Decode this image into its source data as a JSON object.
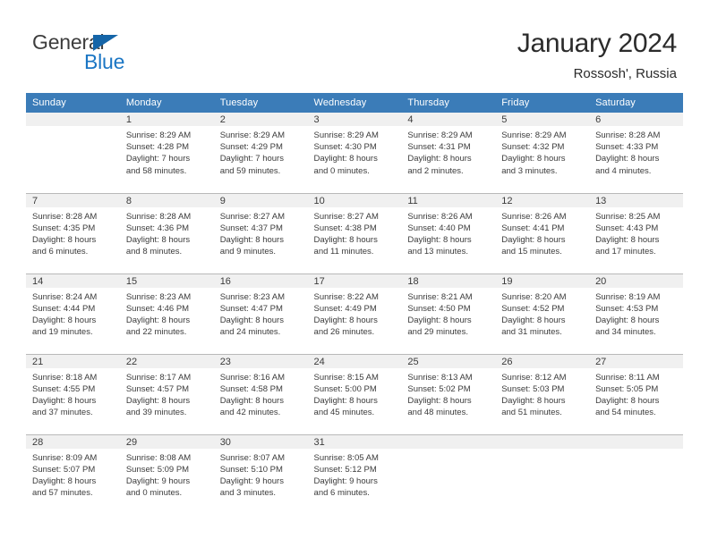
{
  "brand": {
    "name_part1": "General",
    "name_part2": "Blue",
    "triangle_color": "#1565a8",
    "blue_color": "#1b76c4"
  },
  "header": {
    "title": "January 2024",
    "subtitle": "Rossosh', Russia"
  },
  "theme": {
    "header_row_bg": "#3b7cb8",
    "daynum_bg": "#f0f0f0",
    "text_color": "#3b3b3b",
    "border_color": "#b9b9b9"
  },
  "weekdays": [
    "Sunday",
    "Monday",
    "Tuesday",
    "Wednesday",
    "Thursday",
    "Friday",
    "Saturday"
  ],
  "weeks": [
    [
      {
        "day": "",
        "blank": true,
        "sunrise": "",
        "sunset": "",
        "daylight1": "",
        "daylight2": ""
      },
      {
        "day": "1",
        "sunrise": "Sunrise: 8:29 AM",
        "sunset": "Sunset: 4:28 PM",
        "daylight1": "Daylight: 7 hours",
        "daylight2": "and 58 minutes."
      },
      {
        "day": "2",
        "sunrise": "Sunrise: 8:29 AM",
        "sunset": "Sunset: 4:29 PM",
        "daylight1": "Daylight: 7 hours",
        "daylight2": "and 59 minutes."
      },
      {
        "day": "3",
        "sunrise": "Sunrise: 8:29 AM",
        "sunset": "Sunset: 4:30 PM",
        "daylight1": "Daylight: 8 hours",
        "daylight2": "and 0 minutes."
      },
      {
        "day": "4",
        "sunrise": "Sunrise: 8:29 AM",
        "sunset": "Sunset: 4:31 PM",
        "daylight1": "Daylight: 8 hours",
        "daylight2": "and 2 minutes."
      },
      {
        "day": "5",
        "sunrise": "Sunrise: 8:29 AM",
        "sunset": "Sunset: 4:32 PM",
        "daylight1": "Daylight: 8 hours",
        "daylight2": "and 3 minutes."
      },
      {
        "day": "6",
        "sunrise": "Sunrise: 8:28 AM",
        "sunset": "Sunset: 4:33 PM",
        "daylight1": "Daylight: 8 hours",
        "daylight2": "and 4 minutes."
      }
    ],
    [
      {
        "day": "7",
        "sunrise": "Sunrise: 8:28 AM",
        "sunset": "Sunset: 4:35 PM",
        "daylight1": "Daylight: 8 hours",
        "daylight2": "and 6 minutes."
      },
      {
        "day": "8",
        "sunrise": "Sunrise: 8:28 AM",
        "sunset": "Sunset: 4:36 PM",
        "daylight1": "Daylight: 8 hours",
        "daylight2": "and 8 minutes."
      },
      {
        "day": "9",
        "sunrise": "Sunrise: 8:27 AM",
        "sunset": "Sunset: 4:37 PM",
        "daylight1": "Daylight: 8 hours",
        "daylight2": "and 9 minutes."
      },
      {
        "day": "10",
        "sunrise": "Sunrise: 8:27 AM",
        "sunset": "Sunset: 4:38 PM",
        "daylight1": "Daylight: 8 hours",
        "daylight2": "and 11 minutes."
      },
      {
        "day": "11",
        "sunrise": "Sunrise: 8:26 AM",
        "sunset": "Sunset: 4:40 PM",
        "daylight1": "Daylight: 8 hours",
        "daylight2": "and 13 minutes."
      },
      {
        "day": "12",
        "sunrise": "Sunrise: 8:26 AM",
        "sunset": "Sunset: 4:41 PM",
        "daylight1": "Daylight: 8 hours",
        "daylight2": "and 15 minutes."
      },
      {
        "day": "13",
        "sunrise": "Sunrise: 8:25 AM",
        "sunset": "Sunset: 4:43 PM",
        "daylight1": "Daylight: 8 hours",
        "daylight2": "and 17 minutes."
      }
    ],
    [
      {
        "day": "14",
        "sunrise": "Sunrise: 8:24 AM",
        "sunset": "Sunset: 4:44 PM",
        "daylight1": "Daylight: 8 hours",
        "daylight2": "and 19 minutes."
      },
      {
        "day": "15",
        "sunrise": "Sunrise: 8:23 AM",
        "sunset": "Sunset: 4:46 PM",
        "daylight1": "Daylight: 8 hours",
        "daylight2": "and 22 minutes."
      },
      {
        "day": "16",
        "sunrise": "Sunrise: 8:23 AM",
        "sunset": "Sunset: 4:47 PM",
        "daylight1": "Daylight: 8 hours",
        "daylight2": "and 24 minutes."
      },
      {
        "day": "17",
        "sunrise": "Sunrise: 8:22 AM",
        "sunset": "Sunset: 4:49 PM",
        "daylight1": "Daylight: 8 hours",
        "daylight2": "and 26 minutes."
      },
      {
        "day": "18",
        "sunrise": "Sunrise: 8:21 AM",
        "sunset": "Sunset: 4:50 PM",
        "daylight1": "Daylight: 8 hours",
        "daylight2": "and 29 minutes."
      },
      {
        "day": "19",
        "sunrise": "Sunrise: 8:20 AM",
        "sunset": "Sunset: 4:52 PM",
        "daylight1": "Daylight: 8 hours",
        "daylight2": "and 31 minutes."
      },
      {
        "day": "20",
        "sunrise": "Sunrise: 8:19 AM",
        "sunset": "Sunset: 4:53 PM",
        "daylight1": "Daylight: 8 hours",
        "daylight2": "and 34 minutes."
      }
    ],
    [
      {
        "day": "21",
        "sunrise": "Sunrise: 8:18 AM",
        "sunset": "Sunset: 4:55 PM",
        "daylight1": "Daylight: 8 hours",
        "daylight2": "and 37 minutes."
      },
      {
        "day": "22",
        "sunrise": "Sunrise: 8:17 AM",
        "sunset": "Sunset: 4:57 PM",
        "daylight1": "Daylight: 8 hours",
        "daylight2": "and 39 minutes."
      },
      {
        "day": "23",
        "sunrise": "Sunrise: 8:16 AM",
        "sunset": "Sunset: 4:58 PM",
        "daylight1": "Daylight: 8 hours",
        "daylight2": "and 42 minutes."
      },
      {
        "day": "24",
        "sunrise": "Sunrise: 8:15 AM",
        "sunset": "Sunset: 5:00 PM",
        "daylight1": "Daylight: 8 hours",
        "daylight2": "and 45 minutes."
      },
      {
        "day": "25",
        "sunrise": "Sunrise: 8:13 AM",
        "sunset": "Sunset: 5:02 PM",
        "daylight1": "Daylight: 8 hours",
        "daylight2": "and 48 minutes."
      },
      {
        "day": "26",
        "sunrise": "Sunrise: 8:12 AM",
        "sunset": "Sunset: 5:03 PM",
        "daylight1": "Daylight: 8 hours",
        "daylight2": "and 51 minutes."
      },
      {
        "day": "27",
        "sunrise": "Sunrise: 8:11 AM",
        "sunset": "Sunset: 5:05 PM",
        "daylight1": "Daylight: 8 hours",
        "daylight2": "and 54 minutes."
      }
    ],
    [
      {
        "day": "28",
        "sunrise": "Sunrise: 8:09 AM",
        "sunset": "Sunset: 5:07 PM",
        "daylight1": "Daylight: 8 hours",
        "daylight2": "and 57 minutes."
      },
      {
        "day": "29",
        "sunrise": "Sunrise: 8:08 AM",
        "sunset": "Sunset: 5:09 PM",
        "daylight1": "Daylight: 9 hours",
        "daylight2": "and 0 minutes."
      },
      {
        "day": "30",
        "sunrise": "Sunrise: 8:07 AM",
        "sunset": "Sunset: 5:10 PM",
        "daylight1": "Daylight: 9 hours",
        "daylight2": "and 3 minutes."
      },
      {
        "day": "31",
        "sunrise": "Sunrise: 8:05 AM",
        "sunset": "Sunset: 5:12 PM",
        "daylight1": "Daylight: 9 hours",
        "daylight2": "and 6 minutes."
      },
      {
        "day": "",
        "blank": true,
        "sunrise": "",
        "sunset": "",
        "daylight1": "",
        "daylight2": ""
      },
      {
        "day": "",
        "blank": true,
        "sunrise": "",
        "sunset": "",
        "daylight1": "",
        "daylight2": ""
      },
      {
        "day": "",
        "blank": true,
        "sunrise": "",
        "sunset": "",
        "daylight1": "",
        "daylight2": ""
      }
    ]
  ]
}
